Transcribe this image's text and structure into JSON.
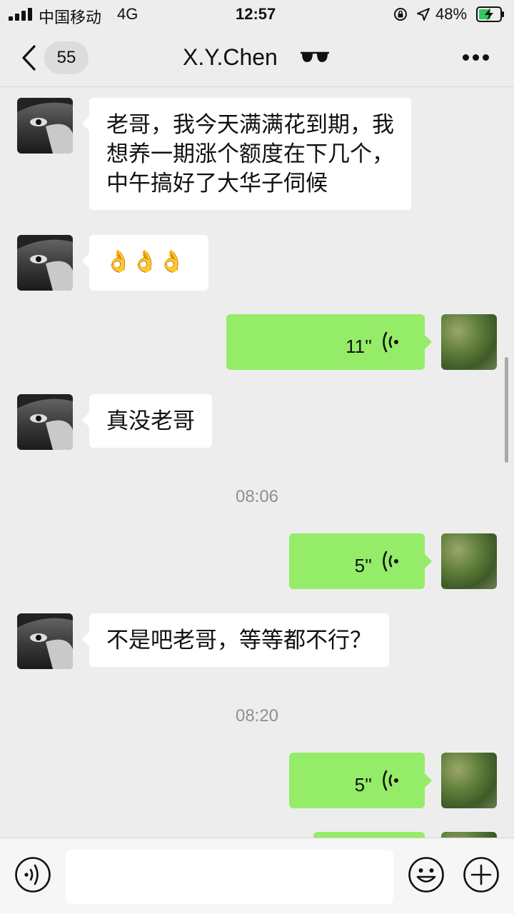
{
  "status_bar": {
    "carrier": "中国移动",
    "network": "4G",
    "time": "12:57",
    "battery_percent": "48%",
    "icons": [
      "signal-icon",
      "rotation-lock-icon",
      "location-arrow-icon",
      "battery-charging-icon"
    ]
  },
  "nav": {
    "back_icon": "chevron-left-icon",
    "unread_count": "55",
    "title": "X.Y.Chen",
    "title_emoji": "sunglasses-icon",
    "more_icon": "more-dots-icon"
  },
  "messages": [
    {
      "from": "peer",
      "type": "text",
      "lines": [
        "老哥，我今天满满花到期，我",
        "想养一期涨个额度在下几个，",
        "中午搞好了大华子伺候"
      ]
    },
    {
      "from": "peer",
      "type": "emoji",
      "text": "👌👌👌"
    },
    {
      "from": "self",
      "type": "voice",
      "duration": "11''"
    },
    {
      "from": "peer",
      "type": "text",
      "lines": [
        "真没老哥"
      ]
    },
    {
      "type": "time",
      "text": "08:06"
    },
    {
      "from": "self",
      "type": "voice",
      "duration": "5''"
    },
    {
      "from": "peer",
      "type": "text",
      "lines": [
        "不是吧老哥，等等都不行？"
      ]
    },
    {
      "type": "time",
      "text": "08:20"
    },
    {
      "from": "self",
      "type": "voice",
      "duration": "5''"
    },
    {
      "from": "self",
      "type": "voice",
      "duration": ""
    }
  ],
  "input_bar": {
    "voice_toggle_icon": "voice-mode-icon",
    "text_value": "",
    "emoji_icon": "emoji-smile-icon",
    "plus_icon": "plus-circle-icon"
  },
  "colors": {
    "background": "#ededed",
    "self_bubble": "#95ec69",
    "peer_bubble": "#ffffff",
    "time_text": "#8f8f8f"
  }
}
